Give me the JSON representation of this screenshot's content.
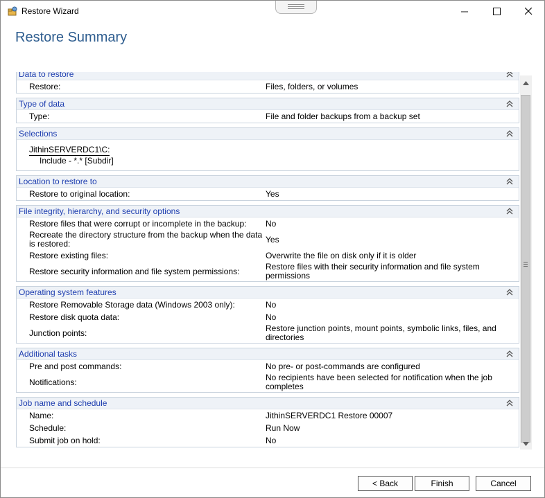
{
  "window": {
    "title": "Restore Wizard"
  },
  "page": {
    "title": "Restore Summary"
  },
  "sections": {
    "data_to_restore": {
      "title": "Data to restore",
      "rows": [
        {
          "label": "Restore:",
          "value": "Files, folders, or volumes"
        }
      ]
    },
    "type_of_data": {
      "title": "Type of data",
      "rows": [
        {
          "label": "Type:",
          "value": "File and folder backups from a backup set"
        }
      ]
    },
    "selections": {
      "title": "Selections",
      "path": "JithinSERVERDC1\\C:",
      "include": "Include - *.* [Subdir]"
    },
    "location": {
      "title": "Location to restore to",
      "rows": [
        {
          "label": "Restore to original location:",
          "value": "Yes"
        }
      ]
    },
    "integrity": {
      "title": "File integrity, hierarchy, and security options",
      "rows": [
        {
          "label": "Restore files that were corrupt or incomplete in the backup:",
          "value": "No"
        },
        {
          "label": "Recreate the directory structure from the backup when the data is restored:",
          "value": "Yes"
        },
        {
          "label": "Restore existing files:",
          "value": "Overwrite the file on disk only if it is older"
        },
        {
          "label": "Restore security information and file system permissions:",
          "value": "Restore files with their security information and file system permissions"
        }
      ]
    },
    "os_features": {
      "title": "Operating system features",
      "rows": [
        {
          "label": "Restore Removable Storage data (Windows 2003 only):",
          "value": "No"
        },
        {
          "label": "Restore disk quota data:",
          "value": "No"
        },
        {
          "label": "Junction points:",
          "value": "Restore junction points, mount points, symbolic links, files, and directories"
        }
      ]
    },
    "additional": {
      "title": "Additional tasks",
      "rows": [
        {
          "label": "Pre and post commands:",
          "value": "No pre- or post-commands are configured"
        },
        {
          "label": "Notifications:",
          "value": "No recipients have been selected for notification when the job completes"
        }
      ]
    },
    "job": {
      "title": "Job name and schedule",
      "rows": [
        {
          "label": "Name:",
          "value": "JithinSERVERDC1 Restore 00007"
        },
        {
          "label": "Schedule:",
          "value": "Run Now"
        },
        {
          "label": "Submit job on hold:",
          "value": "No"
        }
      ]
    }
  },
  "buttons": {
    "back": "< Back",
    "finish": "Finish",
    "cancel": "Cancel"
  },
  "icons": {
    "app": "restore-wizard-icon",
    "collapse": "collapse-chevrons-icon"
  }
}
